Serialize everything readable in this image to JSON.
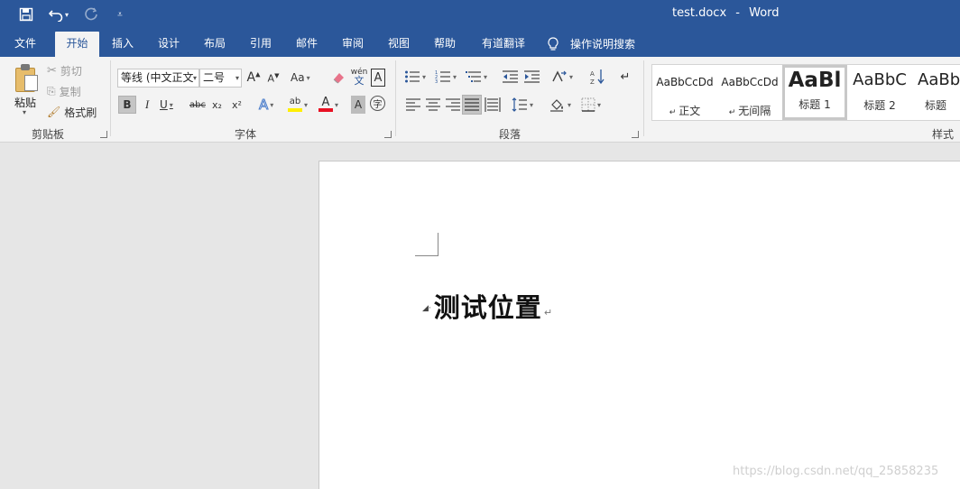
{
  "window": {
    "filename": "test.docx",
    "separator": "-",
    "app_name": "Word"
  },
  "tabs": [
    {
      "label": "文件"
    },
    {
      "label": "开始"
    },
    {
      "label": "插入"
    },
    {
      "label": "设计"
    },
    {
      "label": "布局"
    },
    {
      "label": "引用"
    },
    {
      "label": "邮件"
    },
    {
      "label": "审阅"
    },
    {
      "label": "视图"
    },
    {
      "label": "帮助"
    },
    {
      "label": "有道翻译"
    }
  ],
  "tell_me": {
    "label": "操作说明搜索",
    "icon": "lightbulb-icon"
  },
  "clipboard": {
    "paste_label": "粘贴",
    "cut_label": "剪切",
    "copy_label": "复制",
    "format_painter_label": "格式刷",
    "group_label": "剪贴板"
  },
  "font": {
    "font_name": "等线 (中文正文",
    "font_size": "二号",
    "bold": "B",
    "italic": "I",
    "underline": "U",
    "strikethrough": "abc",
    "subscript": "x₂",
    "superscript": "x²",
    "change_case": "Aa",
    "phonetic": "wén",
    "phonetic_sub": "文",
    "char_border": "A",
    "text_effect": "A",
    "highlight": "ab",
    "font_color": "A",
    "char_shading": "A",
    "enclosed_char": "字",
    "group_label": "字体",
    "font_color_value": "#e81123",
    "highlight_value": "#ffef00"
  },
  "paragraph": {
    "group_label": "段落",
    "sort": "A↓Z"
  },
  "styles": {
    "group_label": "样式",
    "items": [
      {
        "preview": "AaBbCcDd",
        "name": "正文"
      },
      {
        "preview": "AaBbCcDd",
        "name": "无间隔"
      },
      {
        "preview": "AaBl",
        "name": "标题 1"
      },
      {
        "preview": "AaBbC",
        "name": "标题 2"
      },
      {
        "preview": "AaBb",
        "name": "标题"
      }
    ]
  },
  "document": {
    "heading": "测试位置",
    "collapse_mark": "◢·",
    "paragraph_mark": "↵"
  },
  "watermark": "https://blog.csdn.net/qq_25858235",
  "colors": {
    "brand": "#2b579a",
    "ribbon_bg": "#f3f3f3",
    "canvas_bg": "#e6e6e6"
  }
}
